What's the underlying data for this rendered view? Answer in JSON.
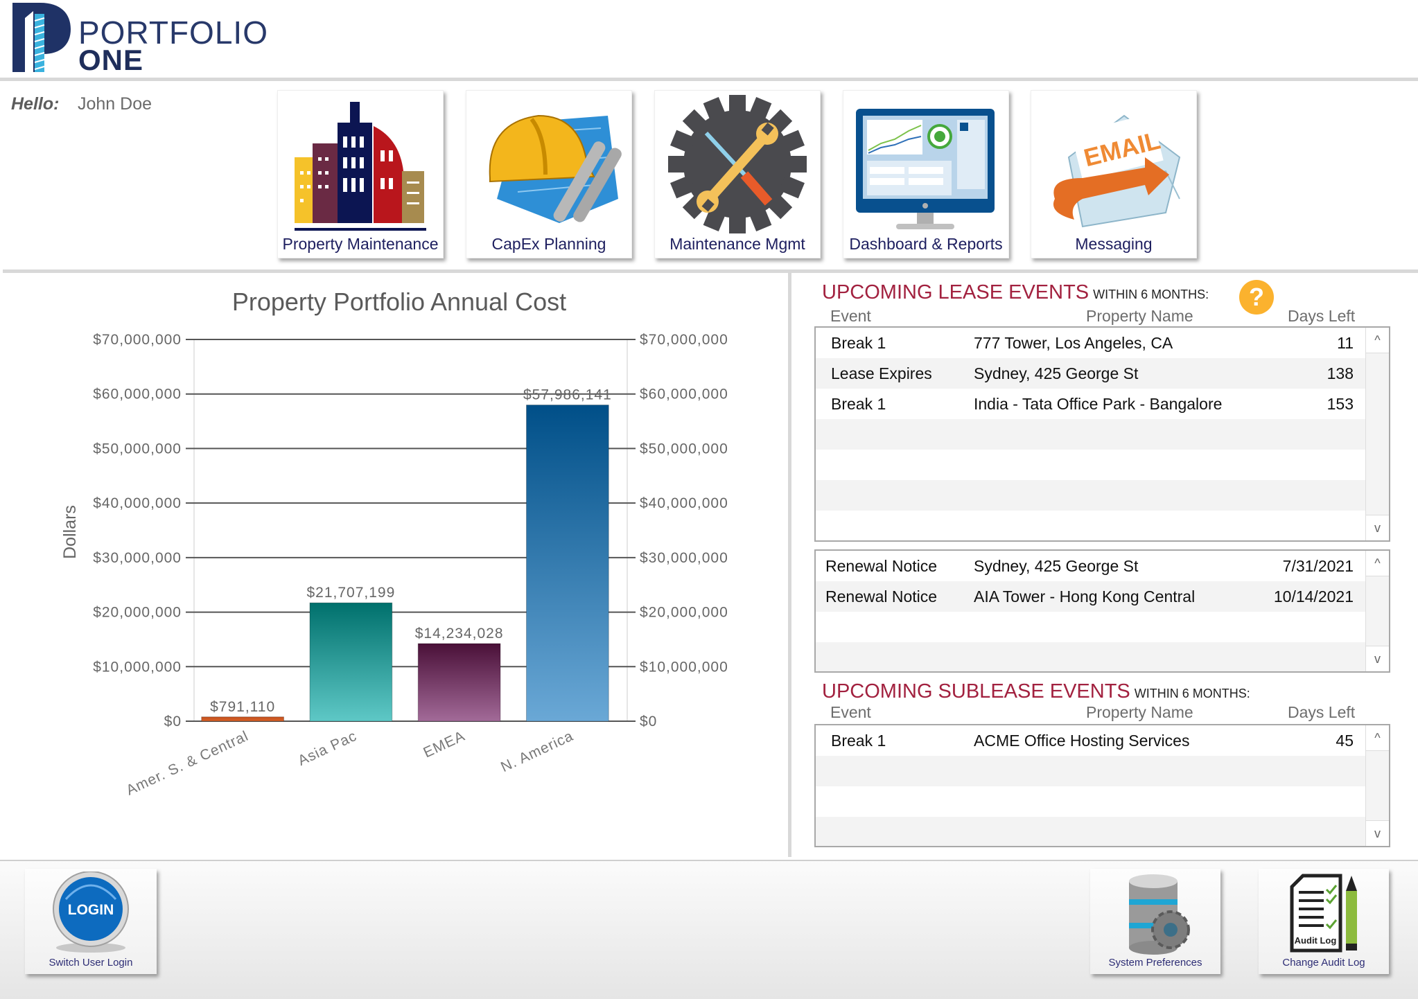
{
  "app": {
    "logo_line1": "PORTFOLIO",
    "logo_line2": "ONE",
    "greeting_label": "Hello:",
    "user_name": "John Doe"
  },
  "nav_tiles": [
    {
      "label": "Property Maintenance",
      "icon": "city-buildings-icon"
    },
    {
      "label": "CapEx Planning",
      "icon": "hardhat-blueprints-icon"
    },
    {
      "label": "Maintenance Mgmt",
      "icon": "gear-tools-icon"
    },
    {
      "label": "Dashboard & Reports",
      "icon": "monitor-dashboard-icon"
    },
    {
      "label": "Messaging",
      "icon": "email-envelope-icon"
    }
  ],
  "chart_data": {
    "type": "bar",
    "title": "Property Portfolio Annual Cost",
    "xlabel": "",
    "ylabel": "Dollars",
    "categories": [
      "Amer. S. & Central",
      "Asia Pac",
      "EMEA",
      "N. America"
    ],
    "values": [
      791110,
      21707199,
      14234028,
      57986141
    ],
    "value_labels": [
      "$791,110",
      "$21,707,199",
      "$14,234,028",
      "$57,986,141"
    ],
    "colors": [
      [
        "#c4501c",
        "#d9632a"
      ],
      [
        "#00706c",
        "#5ec8c6"
      ],
      [
        "#4a1038",
        "#a26a98"
      ],
      [
        "#004f88",
        "#6aa8d6"
      ]
    ],
    "ylim": [
      0,
      70000000
    ],
    "yticks": [
      0,
      10000000,
      20000000,
      30000000,
      40000000,
      50000000,
      60000000,
      70000000
    ],
    "ytick_labels": [
      "$0",
      "$10,000,000",
      "$20,000,000",
      "$30,000,000",
      "$40,000,000",
      "$50,000,000",
      "$60,000,000",
      "$70,000,000"
    ],
    "dual_y_axis": true,
    "grid": true,
    "legend": "none"
  },
  "lease_events": {
    "title": "UPCOMING LEASE EVENTS",
    "subtitle": "WITHIN 6 MONTHS:",
    "help_label": "?",
    "columns": [
      "Event",
      "Property Name",
      "Days Left"
    ],
    "rows": [
      {
        "event": "Break 1",
        "property": "777 Tower, Los Angeles, CA",
        "value": "11"
      },
      {
        "event": "Lease Expires",
        "property": "Sydney, 425 George St",
        "value": "138"
      },
      {
        "event": "Break 1",
        "property": "India - Tata Office Park - Bangalore",
        "value": "153"
      }
    ],
    "notices": [
      {
        "event": "Renewal Notice",
        "property": "Sydney, 425 George St",
        "value": "7/31/2021"
      },
      {
        "event": "Renewal Notice",
        "property": "AIA Tower - Hong Kong Central",
        "value": "10/14/2021"
      }
    ]
  },
  "sublease_events": {
    "title": "UPCOMING SUBLEASE EVENTS",
    "subtitle": "WITHIN 6 MONTHS:",
    "columns": [
      "Event",
      "Property Name",
      "Days Left"
    ],
    "rows": [
      {
        "event": "Break 1",
        "property": "ACME Office Hosting Services",
        "value": "45"
      }
    ]
  },
  "scroll": {
    "up": "^",
    "down": "v"
  },
  "footer": {
    "login_badge": "LOGIN",
    "switch_user_label": "Switch User Login",
    "system_prefs_label": "System Preferences",
    "audit_badge": "Audit Log",
    "audit_label": "Change Audit Log"
  }
}
